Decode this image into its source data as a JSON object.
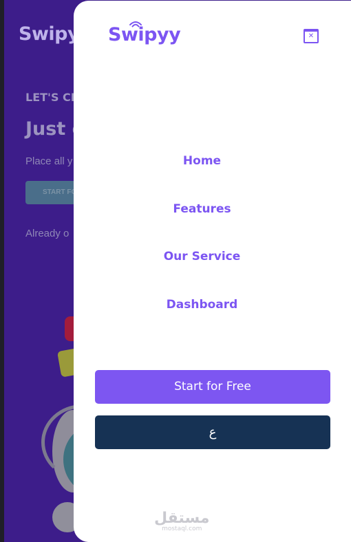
{
  "background": {
    "logo": "Swipyy",
    "kicker": "LET'S CR",
    "headline": "Just c",
    "text": "Place all y",
    "button_label": "START FO",
    "already_text": "Already o"
  },
  "menu": {
    "logo": "Swipyy",
    "nav": [
      {
        "label": "Home"
      },
      {
        "label": "Features"
      },
      {
        "label": "Our Service"
      },
      {
        "label": "Dashboard"
      }
    ],
    "primary_button": "Start for Free",
    "language_button": "ع",
    "watermark": {
      "arabic": "مستقل",
      "latin": "mostaql.com"
    }
  },
  "colors": {
    "accent": "#7c55f2",
    "dark_button": "#163254",
    "background_page": "#3d1d8a"
  }
}
